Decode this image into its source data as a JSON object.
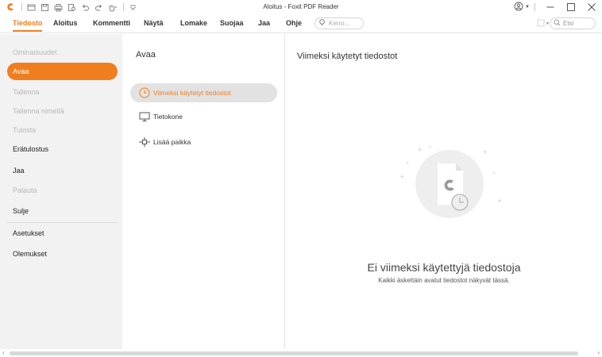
{
  "app": {
    "window_title": "Aloitus - Foxit PDF Reader",
    "accent_color": "#f07e1f"
  },
  "quick_access": [
    {
      "icon": "foxit-logo-icon"
    },
    {
      "icon": "open-file-icon"
    },
    {
      "icon": "save-icon"
    },
    {
      "icon": "print-icon"
    },
    {
      "icon": "print-preview-icon"
    },
    {
      "icon": "undo-icon"
    },
    {
      "icon": "redo-icon"
    },
    {
      "icon": "hand-tool-icon"
    },
    {
      "icon": "customize-qat-icon"
    }
  ],
  "ribbon": {
    "tabs": [
      {
        "label": "Tiedosto",
        "active": true
      },
      {
        "label": "Aloitus"
      },
      {
        "label": "Kommentti"
      },
      {
        "label": "Näytä"
      },
      {
        "label": "Lomake"
      },
      {
        "label": "Suojaa"
      },
      {
        "label": "Jaa"
      },
      {
        "label": "Ohje"
      }
    ],
    "tell_me_placeholder": "Kerro...",
    "search_placeholder": "Etsi"
  },
  "leftnav": {
    "items": [
      {
        "label": "Ominaisuudet",
        "disabled": true
      },
      {
        "label": "Avaa",
        "active": true
      },
      {
        "label": "Tallenna",
        "disabled": true
      },
      {
        "label": "Tallenna nimellä",
        "disabled": true
      },
      {
        "label": "Tulosta",
        "disabled": true
      },
      {
        "label": "Erätulostus"
      },
      {
        "label": "Jaa"
      },
      {
        "label": "Palauta",
        "disabled": true
      },
      {
        "label": "Sulje"
      },
      {
        "label": "Asetukset"
      },
      {
        "label": "Olemukset"
      }
    ]
  },
  "open_pane": {
    "title": "Avaa",
    "places": [
      {
        "label": "Viimeksi käytetyt tiedostot",
        "icon": "clock-icon",
        "active": true
      },
      {
        "label": "Tietokone",
        "icon": "computer-icon"
      },
      {
        "label": "Lisää paikka",
        "icon": "add-place-icon"
      }
    ]
  },
  "recent_pane": {
    "title": "Viimeksi käytetyt tiedostot",
    "empty_title": "Ei viimeksi käytettyjä tiedostoja",
    "empty_subtitle": "Kaikki äskettäin avatut tiedostot näkyvät tässä."
  }
}
